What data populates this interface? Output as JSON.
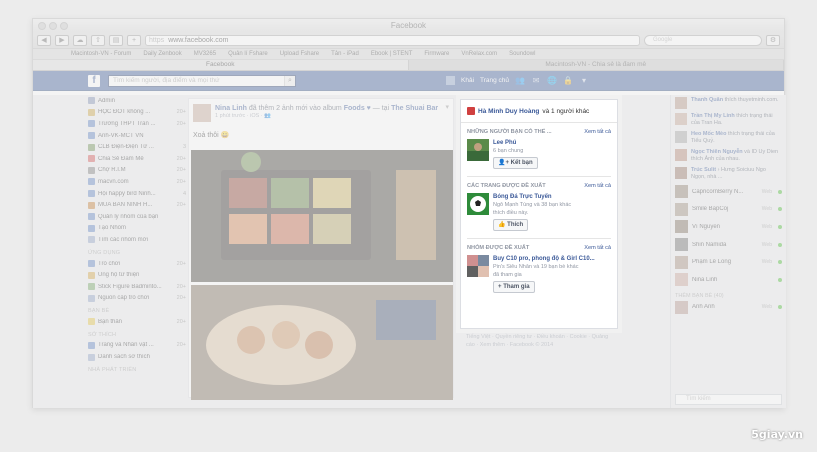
{
  "window": {
    "title": "Facebook"
  },
  "toolbar": {
    "url_prefix": "https",
    "url": "www.facebook.com",
    "search_placeholder": "Google"
  },
  "bookmarks": [
    "Macintosh-VN - Forum",
    "Daily Zenbook",
    "MV3265",
    "Quản lí Fshare",
    "Upload Fshare",
    "Tản - iPad",
    "Ebook | STENT",
    "Firmware",
    "VnRelax.com",
    "Soundowl"
  ],
  "tabs": [
    "Facebook",
    "Macintosh-VN - Chia sẻ là đam mê"
  ],
  "fb": {
    "search_placeholder": "Tìm kiếm người, địa điểm và mọi thứ",
    "user": "Khải",
    "home": "Trang chủ"
  },
  "left": {
    "items": [
      {
        "label": "Admin",
        "count": ""
      },
      {
        "label": "HỌC ĐỐT không ...",
        "count": "20+"
      },
      {
        "label": "Trường THPT Trần ...",
        "count": "20+"
      },
      {
        "label": "Anh-VK-MCT VN",
        "count": ""
      },
      {
        "label": "CLB Điện-Điện Tử ...",
        "count": "3"
      },
      {
        "label": "Chia Sẻ Đam Mê",
        "count": "20+"
      },
      {
        "label": "Chợ R.I.M",
        "count": "20+"
      },
      {
        "label": "macvn.com",
        "count": "20+"
      },
      {
        "label": "Hội happy bird Ninh...",
        "count": "4"
      },
      {
        "label": "MUA BÁN NINH H...",
        "count": "20+"
      },
      {
        "label": "Quản lý nhóm của bạn",
        "count": ""
      },
      {
        "label": "Tạo Nhóm",
        "count": ""
      },
      {
        "label": "Tìm các nhóm mới",
        "count": ""
      }
    ],
    "apps_head": "ỨNG DỤNG",
    "apps": [
      {
        "label": "Trò chơi",
        "count": "20+"
      },
      {
        "label": "Ủng hộ từ thiện",
        "count": ""
      },
      {
        "label": "Stick Figure Badminto...",
        "count": "20+"
      },
      {
        "label": "Nguồn cấp trò chơi",
        "count": "20+"
      }
    ],
    "friends_head": "BẠN BÈ",
    "friends": [
      {
        "label": "Bạn thân",
        "count": "20+"
      }
    ],
    "pages_head": "SỞ THÍCH",
    "pages": [
      {
        "label": "Trang và Nhân vật ...",
        "count": "20+"
      },
      {
        "label": "Danh sách sở thích",
        "count": ""
      }
    ],
    "more_head": "NHÀ PHÁT TRIỂN"
  },
  "post": {
    "author": "Nina Linh",
    "action": "đã thêm 2 ảnh mới vào album",
    "album": "Foods ♥",
    "connector": "— tại",
    "place": "The Shuai Bar",
    "meta": "1 phút trước · iOS · ",
    "message": "Xoả thôi 😀"
  },
  "suggestions": {
    "top_name": "Hà Minh Duy Hoàng",
    "top_rest": "và 1 người khác",
    "see_all": "Xem tất cả",
    "sections": [
      {
        "head": "NHỮNG NGƯỜI BẠN CÓ THỂ ...",
        "title": "Lee Phú",
        "line1": "6 bạn chung",
        "line2": "",
        "button": "Kết bạn",
        "btn_icon": "👤+"
      },
      {
        "head": "CÁC TRANG ĐƯỢC ĐỀ XUẤT",
        "title": "Bóng Đá Trực Tuyến",
        "line1": "Ngô Mạnh Tùng và 38 bạn khác",
        "line2": "thích điều này.",
        "button": "Thích",
        "btn_icon": "👍"
      },
      {
        "head": "NHÓM ĐƯỢC ĐỀ XUẤT",
        "title": "Buy C10 pro, phong độ & Girl C10...",
        "line1": "Pin's Siêu Nhân và 19 bạn bè khác",
        "line2": "đã tham gia",
        "button": "Tham gia",
        "btn_icon": "+"
      }
    ],
    "footer": "Tiếng Việt · Quyền riêng tư · Điều khoản · Cookie · Quảng cáo · Xem thêm ·  Facebook © 2014"
  },
  "ticker": [
    {
      "name": "Thanh Quân",
      "text": "thích thuyetminh.com."
    },
    {
      "name": "Trần Thị My Linh",
      "text": "thích trạng thái của Tran Ha."
    },
    {
      "name": "Heo Mốc Mèo",
      "text": "thích trạng thái của Tiểu Quỷ."
    },
    {
      "name": "Ngọc Thiên Nguyễn",
      "text": "và ID Uy Dien thích Ảnh của nhau."
    },
    {
      "name": "Trúc Sulit",
      "text": "› Hưng Soiciuu Ngo Ngọn, nhà ...",
      "extra": ""
    }
  ],
  "chat": [
    {
      "name": "CapricornBerry N...",
      "status": "Web"
    },
    {
      "name": "Smile BắpCõj",
      "status": "Web"
    },
    {
      "name": "Vĩ Nguyễn",
      "status": "Web"
    },
    {
      "name": "Shin Namida",
      "status": "Web"
    },
    {
      "name": "Phạm Lê Long",
      "status": "Web"
    },
    {
      "name": "Nina Linh",
      "status": ""
    }
  ],
  "chat_head": "THÊM BẠN BÈ (40)",
  "chat_more": [
    {
      "name": "Anh Anh",
      "status": "Web"
    }
  ],
  "chat_search": "Tìm kiếm",
  "watermark": "5giay.vn"
}
